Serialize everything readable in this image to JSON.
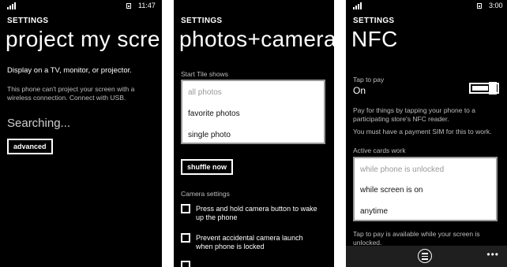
{
  "panel1": {
    "clock": "11:47",
    "header": "SETTINGS",
    "title": "project my scre",
    "subtitle": "Display on a TV, monitor, or projector.",
    "note_line1": "This phone can't project your screen with a",
    "note_line2": "wireless connection. Connect with USB.",
    "status": "Searching...",
    "advanced_button": "advanced"
  },
  "panel2": {
    "header": "SETTINGS",
    "title": "photos+camera",
    "start_tile_label": "Start Tile shows",
    "start_tile_options": [
      "all photos",
      "favorite photos",
      "single photo"
    ],
    "shuffle_button": "shuffle now",
    "camera_settings_label": "Camera settings",
    "check1_line1": "Press and hold camera button to wake",
    "check1_line2": "up the phone",
    "check2_line1": "Prevent accidental camera launch",
    "check2_line2": "when phone is locked"
  },
  "panel3": {
    "clock": "3:00",
    "header": "SETTINGS",
    "title": "NFC",
    "tap_to_pay_label": "Tap to pay",
    "tap_to_pay_value": "On",
    "pay_desc_line1": "Pay for things by tapping your phone to a",
    "pay_desc_line2": "participating store's NFC reader.",
    "sim_note": "You must have a payment SIM for this to work.",
    "active_cards_label": "Active cards work",
    "active_cards_options": [
      "while phone is unlocked",
      "while screen is on",
      "anytime"
    ],
    "tap_note_line1": "Tap to pay is available while your screen is",
    "tap_note_line2": "unlocked.",
    "more_button": "•••"
  },
  "icons": {
    "signal": "signal-strength-icon",
    "battery": "battery-icon",
    "list": "list-icon"
  },
  "colors": {
    "background": "#000000",
    "text": "#ffffff",
    "secondary_text": "#bdbdbd",
    "listbox_bg": "#ffffff",
    "appbar": "#1f1f1f"
  }
}
